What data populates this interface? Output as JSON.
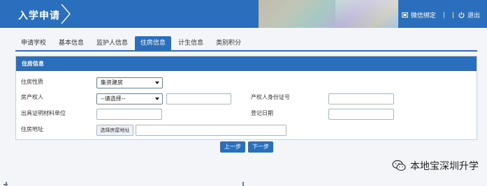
{
  "header": {
    "title": "入学申请",
    "wechat_bind_label": "微信绑定",
    "separator": "|",
    "logout_label": "退出"
  },
  "tabs": [
    {
      "label": "申请学校",
      "active": false
    },
    {
      "label": "基本信息",
      "active": false
    },
    {
      "label": "监护人信息",
      "active": false
    },
    {
      "label": "住房信息",
      "active": true
    },
    {
      "label": "计生信息",
      "active": false
    },
    {
      "label": "类别积分",
      "active": false
    }
  ],
  "panel": {
    "title": "住房信息",
    "housing_nature_label": "住房性质",
    "housing_nature_value": "集资建房",
    "owner_label": "房产权人",
    "owner_value": "--请选择--",
    "owner_id_label": "产权人身份证号",
    "issuer_label": "出具证明材料单位",
    "reg_date_label": "登记日期",
    "address_label": "住房地址",
    "select_address_button": "选择房屋地址"
  },
  "nav": {
    "prev_label": "上一步",
    "next_label": "下一步"
  },
  "watermark": {
    "text": "本地宝深圳升学"
  },
  "colors": {
    "primary": "#2a6fbd",
    "panel_border": "#c9d3df",
    "background": "#f3f5f8"
  }
}
